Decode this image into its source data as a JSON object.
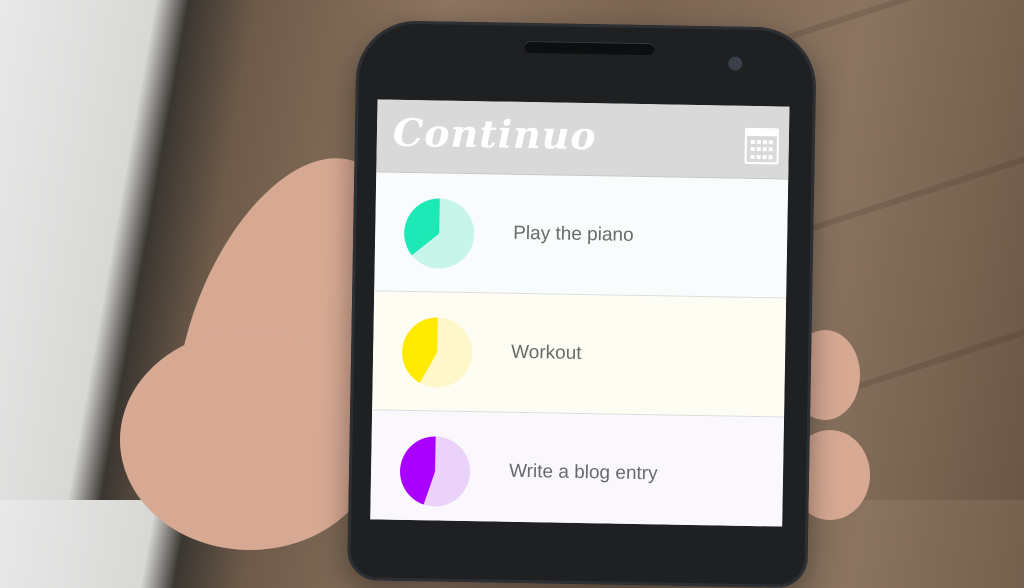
{
  "app": {
    "title": "Continuo",
    "calendar_icon": "calendar-icon"
  },
  "tasks": [
    {
      "label": "Play the piano",
      "progress": 0.36,
      "color": "#1de9b6",
      "light": "#c8f5ea",
      "bg": "#f8fcfc"
    },
    {
      "label": "Workout",
      "progress": 0.42,
      "color": "#ffea00",
      "light": "#fdf7c9",
      "bg": "#fdfdf4"
    },
    {
      "label": "Write a blog entry",
      "progress": 0.45,
      "color": "#aa00ff",
      "light": "#ebd2fb",
      "bg": "#fbf8fd"
    }
  ]
}
